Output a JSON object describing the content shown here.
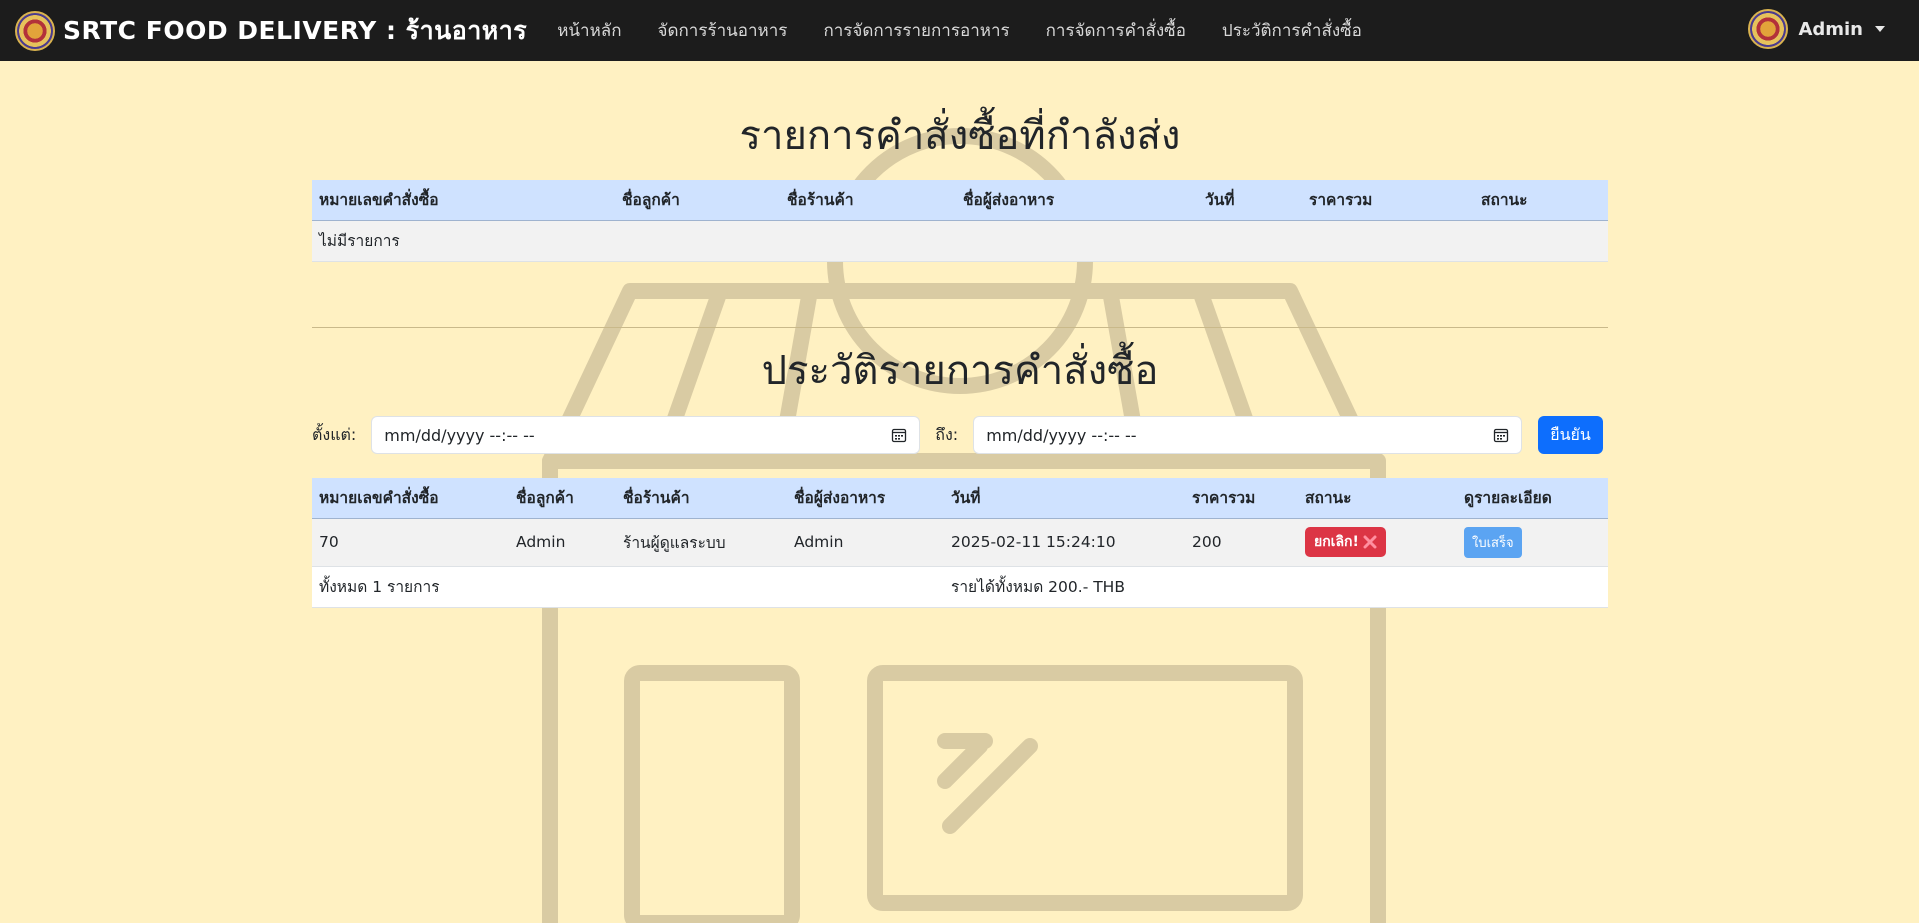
{
  "navbar": {
    "brand": "SRTC FOOD DELIVERY : ร้านอาหาร",
    "links": [
      "หน้าหลัก",
      "จัดการร้านอาหาร",
      "การจัดการรายการอาหาร",
      "การจัดการคำสั่งซื้อ",
      "ประวัติการคำสั่งซื้อ"
    ],
    "user": "Admin"
  },
  "active_orders": {
    "title": "รายการคำสั่งซื้อที่กำลังส่ง",
    "headers": [
      "หมายเลขคำสั่งซื้อ",
      "ชื่อลูกค้า",
      "ชื่อร้านค้า",
      "ชื่อผู้ส่งอาหาร",
      "วันที่",
      "ราคารวม",
      "สถานะ"
    ],
    "empty_text": "ไม่มีรายการ"
  },
  "history": {
    "title": "ประวัติรายการคำสั่งซื้อ",
    "from_label": "ตั้งแต่:",
    "to_label": "ถึง:",
    "from_value": "mm/dd/yyyy --:-- --",
    "to_value": "mm/dd/yyyy --:-- --",
    "confirm_label": "ยืนยัน",
    "headers": [
      "หมายเลขคำสั่งซื้อ",
      "ชื่อลูกค้า",
      "ชื่อร้านค้า",
      "ชื่อผู้ส่งอาหาร",
      "วันที่",
      "ราคารวม",
      "สถานะ",
      "ดูรายละเอียด"
    ],
    "rows": [
      {
        "order_id": "70",
        "customer": "Admin",
        "store": "ร้านผู้ดูแลระบบ",
        "rider": "Admin",
        "date": "2025-02-11 15:24:10",
        "total": "200",
        "status": "ยกเลิก!",
        "status_icon": "cross-icon",
        "action": "ใบเสร็จ"
      }
    ],
    "summary_count": "ทั้งหมด 1 รายการ",
    "summary_income": "รายได้ทั้งหมด 200.- THB"
  },
  "colors": {
    "navbar_bg": "#1c1c1c",
    "page_bg": "#fff1c2",
    "table_header_bg": "#cfe2ff",
    "primary": "#0d6efd",
    "danger": "#dc3545",
    "illustration": "#d9cba3"
  }
}
